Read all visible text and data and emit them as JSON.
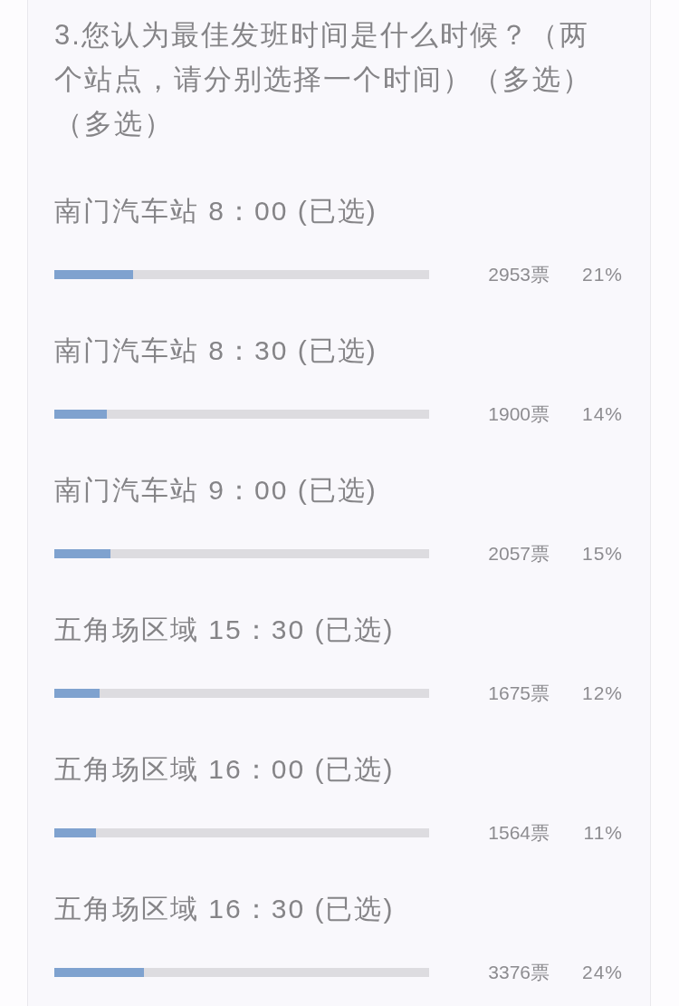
{
  "question": {
    "title": "3.您认为最佳发班时间是什么时候？（两个站点，请分别选择一个时间）（多选）（多选）"
  },
  "options": [
    {
      "label": "南门汽车站 8：00 (已选)",
      "level": 0.21,
      "votes": "2953票",
      "percent": "21%"
    },
    {
      "label": "南门汽车站 8：30 (已选)",
      "level": 0.14,
      "votes": "1900票",
      "percent": "14%"
    },
    {
      "label": "南门汽车站 9：00 (已选)",
      "level": 0.15,
      "votes": "2057票",
      "percent": "15%"
    },
    {
      "label": "五角场区域 15：30 (已选)",
      "level": 0.12,
      "votes": "1675票",
      "percent": "12%"
    },
    {
      "label": "五角场区域 16：00 (已选)",
      "level": 0.11,
      "votes": "1564票",
      "percent": "11%"
    },
    {
      "label": "五角场区域 16：30 (已选)",
      "level": 0.24,
      "votes": "3376票",
      "percent": "24%"
    }
  ]
}
